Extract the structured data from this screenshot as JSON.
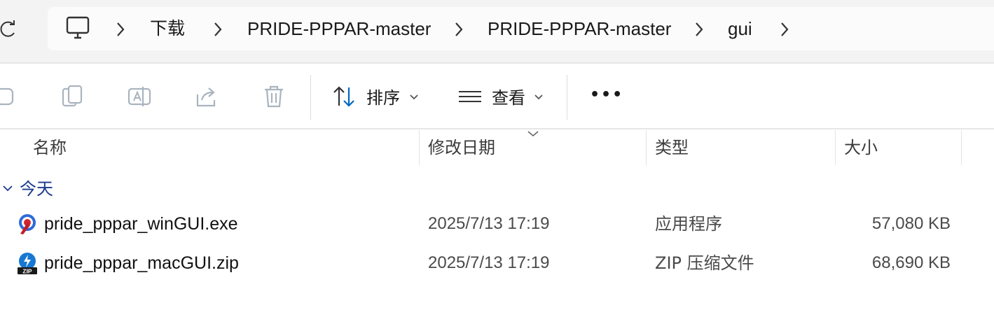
{
  "address_bar": {
    "refresh_icon": "refresh-icon",
    "root_icon": "this-pc-icon",
    "breadcrumbs": [
      "下载",
      "PRIDE-PPPAR-master",
      "PRIDE-PPPAR-master",
      "gui"
    ]
  },
  "toolbar": {
    "icons": [
      "cut-icon",
      "copy-icon",
      "rename-icon",
      "share-icon",
      "delete-icon"
    ],
    "sort_label": "排序",
    "view_label": "查看",
    "more_label": "•••"
  },
  "columns": {
    "name": "名称",
    "date": "修改日期",
    "type": "类型",
    "size": "大小"
  },
  "group": {
    "label": "今天"
  },
  "files": [
    {
      "name": "pride_pppar_winGUI.exe",
      "date": "2025/7/13 17:19",
      "type": "应用程序",
      "size": "57,080 KB",
      "icon": "exe-app-icon"
    },
    {
      "name": "pride_pppar_macGUI.zip",
      "date": "2025/7/13 17:19",
      "type": "ZIP 压缩文件",
      "size": "68,690 KB",
      "icon": "zip-archive-icon"
    }
  ],
  "colors": {
    "accent": "#0067c0",
    "group_label": "#1b3a8f",
    "disabled_icon": "#a9b4bf"
  }
}
